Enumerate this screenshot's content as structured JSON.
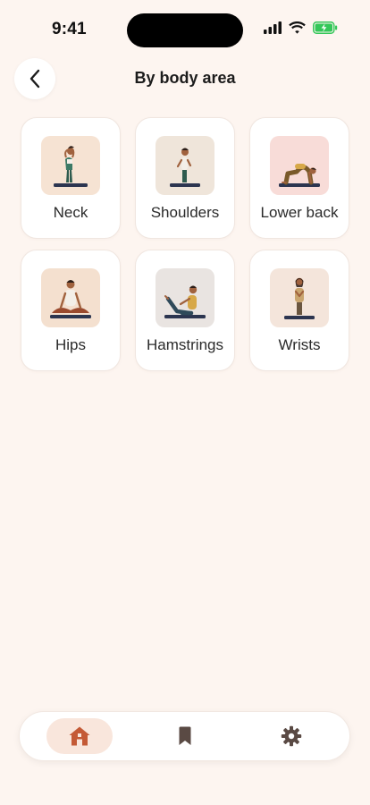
{
  "status_bar": {
    "time": "9:41",
    "battery_color": "#34c759"
  },
  "header": {
    "back_icon": "chevron-left-icon",
    "title": "By body area"
  },
  "areas": [
    {
      "label": "Neck",
      "bg": "#f6e3d3"
    },
    {
      "label": "Shoulders",
      "bg": "#efe5da"
    },
    {
      "label": "Lower back",
      "bg": "#f8dcd8"
    },
    {
      "label": "Hips",
      "bg": "#f4e0cf"
    },
    {
      "label": "Hamstrings",
      "bg": "#e9e4e1"
    },
    {
      "label": "Wrists",
      "bg": "#f4e5db"
    }
  ],
  "bottom_nav": {
    "items": [
      {
        "icon": "home-icon",
        "active": true
      },
      {
        "icon": "bookmark-icon",
        "active": false
      },
      {
        "icon": "gear-icon",
        "active": false
      }
    ],
    "accent": "#c45a36",
    "inactive_color": "#5a4a44"
  }
}
